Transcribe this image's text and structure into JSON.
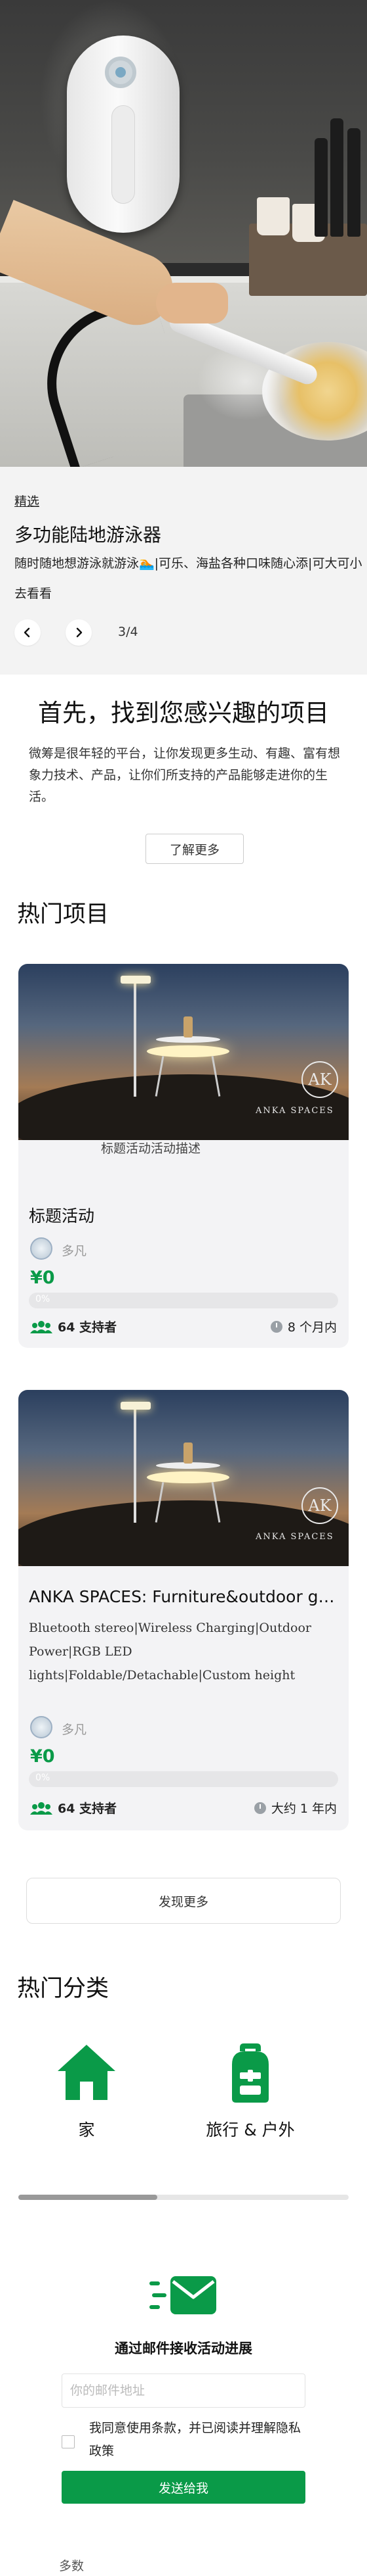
{
  "banner": {
    "tag": "精选",
    "title": "多功能陆地游泳器",
    "description": "随时随地想游泳就游泳🏊|可乐、海盐各种口味随心添|可大可小",
    "more_link": "去看看",
    "prev_icon": "chevron-left-icon",
    "next_icon": "chevron-right-icon",
    "pager": "3/4"
  },
  "intro": {
    "title": "首先，找到您感兴趣的项目",
    "description": "微筹是很年轻的平台，让你发现更多生动、有趣、富有想象力技术、产品，让你们所支持的产品能够走进你的生活。",
    "learn_more": "了解更多"
  },
  "hot_projects": {
    "title": "热门项目",
    "cards": [
      {
        "image_brand": "ANKA SPACES",
        "image_logo": "AK",
        "subtitle": "标题活动活动描述",
        "title": "标题活动",
        "creator": "多凡",
        "amount": "¥0",
        "progress_label": "0%",
        "progress": 0,
        "backers": "64 支持者",
        "time_left": "8 个月内"
      },
      {
        "image_brand": "ANKA SPACES",
        "image_logo": "AK",
        "title": "ANKA SPACES: Furniture&outdoor gea...",
        "description": "Bluetooth stereo|Wireless Charging|Outdoor Power|RGB LED lights|Foldable/Detachable|Custom height",
        "creator": "多凡",
        "amount": "¥0",
        "progress_label": "0%",
        "progress": 0,
        "backers": "64 支持者",
        "time_left": "大约 1 年内"
      }
    ],
    "discover_more": "发现更多"
  },
  "categories": {
    "title": "热门分类",
    "items": [
      {
        "label": "家",
        "icon": "home-icon",
        "color": "#0a9a48"
      },
      {
        "label": "旅行 & 户外",
        "icon": "backpack-icon",
        "color": "#0a9a48"
      }
    ],
    "scroll_fraction": 0.42
  },
  "newsletter": {
    "icon": "mail-send-icon",
    "title": "通过邮件接收活动进展",
    "email_placeholder": "你的邮件地址",
    "agree_text": "我同意使用条款，并已阅读并理解隐私政策",
    "send_label": "发送给我"
  },
  "footer": {
    "peek_text": "多数"
  },
  "colors": {
    "accent": "#0a9a48",
    "banner_bg": "#f3f3f3",
    "card_bg": "#f3f3f5"
  }
}
